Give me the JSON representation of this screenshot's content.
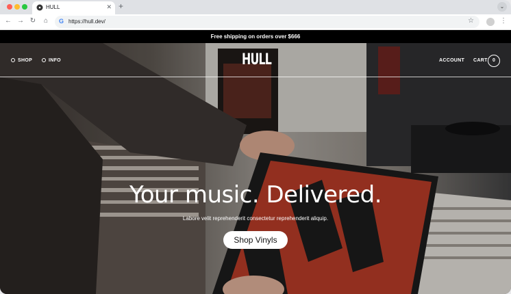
{
  "browser": {
    "tab_title": "HULL",
    "new_tab": "+",
    "url": "https://hull.dev/"
  },
  "site": {
    "announcement": "Free shipping on orders over $666",
    "nav_left": [
      "SHOP",
      "INFO"
    ],
    "logo": "HULL",
    "account": "ACCOUNT",
    "cart": "CART",
    "cart_count": "0"
  },
  "hero": {
    "headline": "Your music. Delivered.",
    "subline": "Labore velit reprehenderit consectetur reprehenderit aliquip.",
    "cta": "Shop Vinyls"
  },
  "colors": {
    "announcement_bg": "#000000",
    "cta_bg": "#ffffff",
    "record_red": "#b33a26"
  }
}
